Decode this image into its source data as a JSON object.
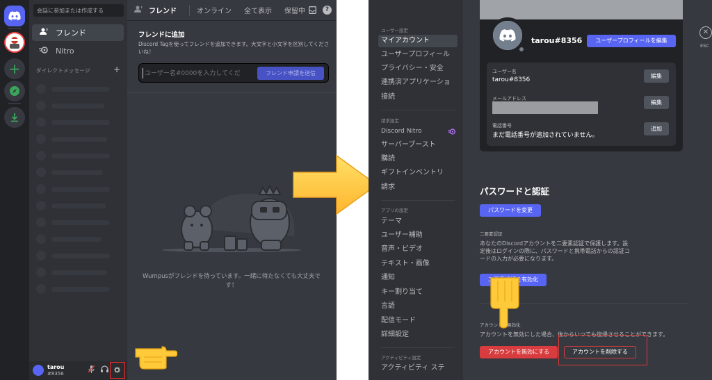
{
  "left": {
    "search_placeholder": "会話に参加または作成する",
    "nav": {
      "friends": "フレンド",
      "nitro": "Nitro"
    },
    "dm_header": "ダイレクトメッセージ",
    "dm_add": "+",
    "user": {
      "name": "tarou",
      "tag": "#8356"
    },
    "topbar": {
      "title": "フレンド",
      "tabs": [
        "オンライン",
        "全て表示",
        "保留中"
      ],
      "help": "?"
    },
    "add_friend": {
      "title": "フレンドに追加",
      "description": "Discord Tagを使ってフレンドを追加できます。大文字と小文字を区別してくださいね！",
      "input_placeholder": "ユーザー名#0000を入力してくだ",
      "button": "フレンド申請を送信"
    },
    "empty_text": "Wumpusがフレンドを待っています。一緒に待たなくても大丈夫です！"
  },
  "settings": {
    "sidebar": {
      "user_settings_header": "ユーザー設定",
      "user_items": [
        "マイアカウント",
        "ユーザープロフィール",
        "プライバシー・安全",
        "連携済アプリケーショ",
        "接続"
      ],
      "billing_header": "請求設定",
      "billing_items": [
        "Discord Nitro",
        "サーバーブースト",
        "購読",
        "ギフトインベントリ",
        "請求"
      ],
      "app_header": "アプリの設定",
      "app_items": [
        "テーマ",
        "ユーザー補助",
        "音声・ビデオ",
        "テキスト・画像",
        "通知",
        "キー割り当て",
        "言語",
        "配信モード",
        "詳細設定"
      ],
      "activity_header": "アクティビティ設定",
      "activity_items": [
        "アクティビティ ステ"
      ]
    },
    "profile": {
      "name": "tarou#8356",
      "edit_button": "ユーザープロフィールを編集",
      "username_label": "ユーザー名",
      "username_value": "tarou#8356",
      "email_label": "メールアドレス",
      "phone_label": "電話番号",
      "phone_value": "まだ電話番号が追加されていません。",
      "edit_label": "編集",
      "add_label": "追加"
    },
    "close_label": "ESC",
    "password": {
      "title": "パスワードと認証",
      "change_button": "パスワードを変更",
      "twofa_header": "二要素認証",
      "twofa_description": "あなたのDiscordアカウントを二要素認証で保護します。設定後はログインの際に、パスワードと携帯電話からの認証コードの入力が必要になります。",
      "twofa_button": "二要素認証を有効化"
    },
    "disable": {
      "header": "アカウントの無効化",
      "description": "アカウントを無効にした場合、後からいつでも復帰させることができます。",
      "disable_button": "アカウントを無効にする",
      "delete_button": "アカウントを削除する"
    }
  },
  "colors": {
    "blurple": "#5865f2",
    "danger": "#d83c3e",
    "highlight_red": "#ff2a2a",
    "arrow_yellow": "#ffc93c",
    "green": "#3ba55c"
  },
  "icons": {
    "home": "discord-logo-icon",
    "friends": "friends-wave-icon",
    "nitro": "nitro-icon",
    "settings": "gear-icon",
    "hand": "pointing-hand-icon"
  }
}
